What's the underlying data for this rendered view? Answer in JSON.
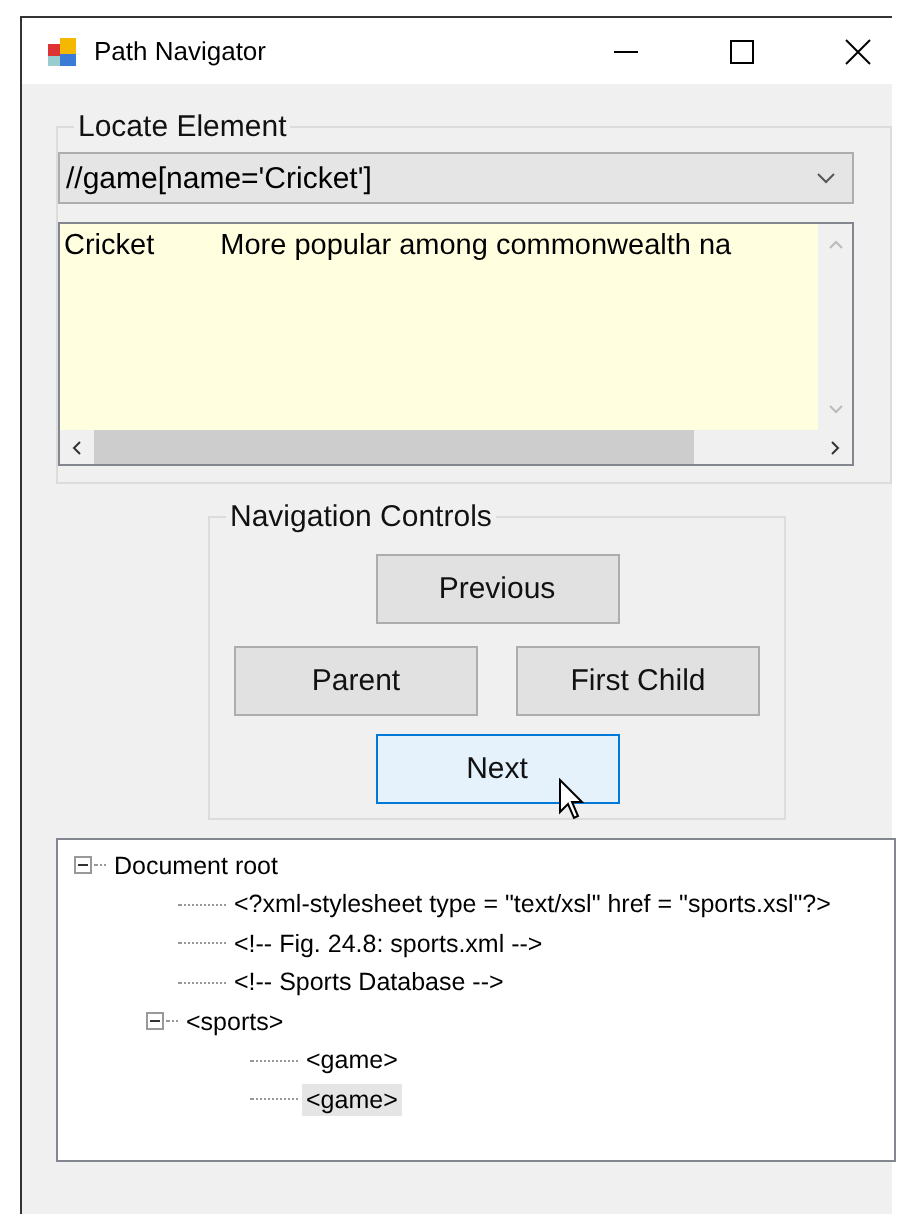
{
  "window": {
    "title": "Path Navigator"
  },
  "locate_group": {
    "label": "Locate Element",
    "combo": {
      "value": "//game[name='Cricket']"
    },
    "result": {
      "columns": [
        "Cricket",
        "More popular among commonwealth na"
      ]
    }
  },
  "nav_group": {
    "label": "Navigation Controls",
    "buttons": [
      {
        "label": "Previous",
        "focused": false
      },
      {
        "label": "Parent",
        "focused": false
      },
      {
        "label": "First Child",
        "focused": false
      },
      {
        "label": "Next",
        "focused": true
      }
    ]
  },
  "tree": [
    {
      "label": "Document root",
      "expanded": true,
      "selected": false,
      "children": [
        {
          "label": "<?xml-stylesheet type = \"text/xsl\" href = \"sports.xsl\"?>",
          "selected": false
        },
        {
          "label": "<!-- Fig. 24.8: sports.xml -->",
          "selected": false
        },
        {
          "label": "<!-- Sports Database -->",
          "selected": false
        },
        {
          "label": "<sports>",
          "expanded": true,
          "selected": false,
          "children": [
            {
              "label": "<game>",
              "selected": false
            },
            {
              "label": "<game>",
              "selected": true
            }
          ]
        }
      ]
    }
  ]
}
